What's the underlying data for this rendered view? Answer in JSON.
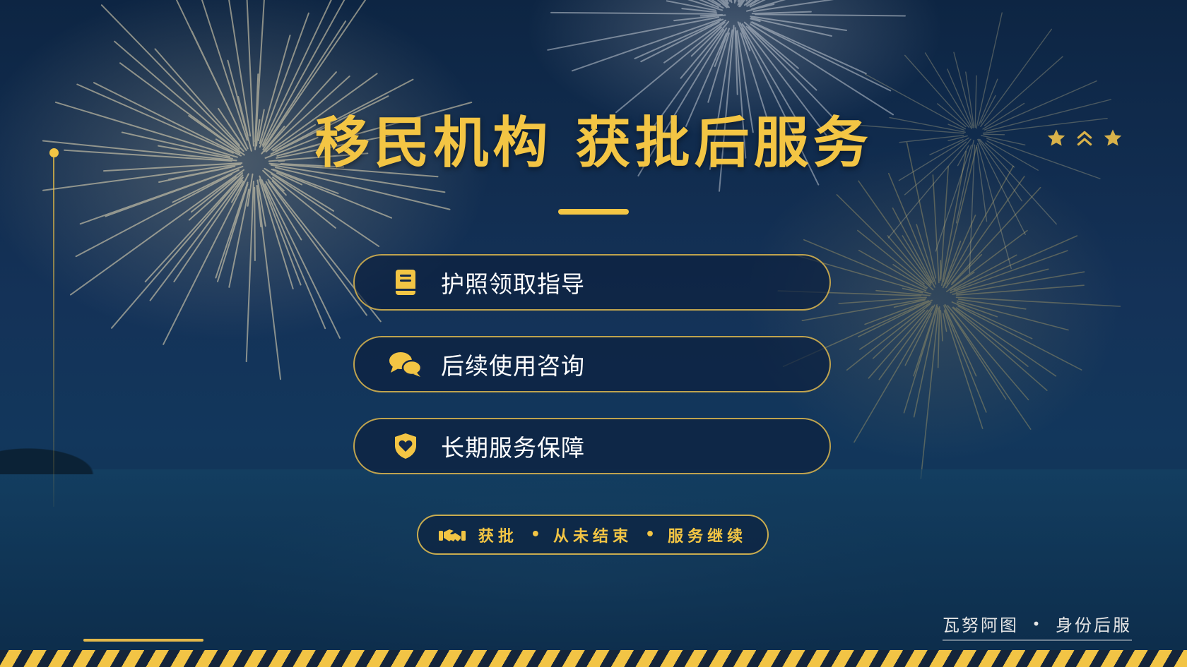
{
  "title": "移民机构 获批后服务",
  "services": [
    {
      "label": "护照领取指导",
      "icon": "passport-book-icon"
    },
    {
      "label": "后续使用咨询",
      "icon": "chat-bubbles-icon"
    },
    {
      "label": "长期服务保障",
      "icon": "shield-heart-icon"
    }
  ],
  "slogan": {
    "icon": "handshake-icon",
    "parts": [
      "获批",
      "从未结束",
      "服务继续"
    ],
    "separator": "•"
  },
  "footer": {
    "brand": "瓦努阿图",
    "separator": "•",
    "tagline": "身份后服"
  },
  "decorations": {
    "top_right_icons": [
      "star-icon",
      "chevrons-up-icon",
      "star-icon"
    ]
  },
  "colors": {
    "accent_gold": "#f3c544",
    "background_navy": "#0f2a4a",
    "text_white": "#ffffff"
  }
}
